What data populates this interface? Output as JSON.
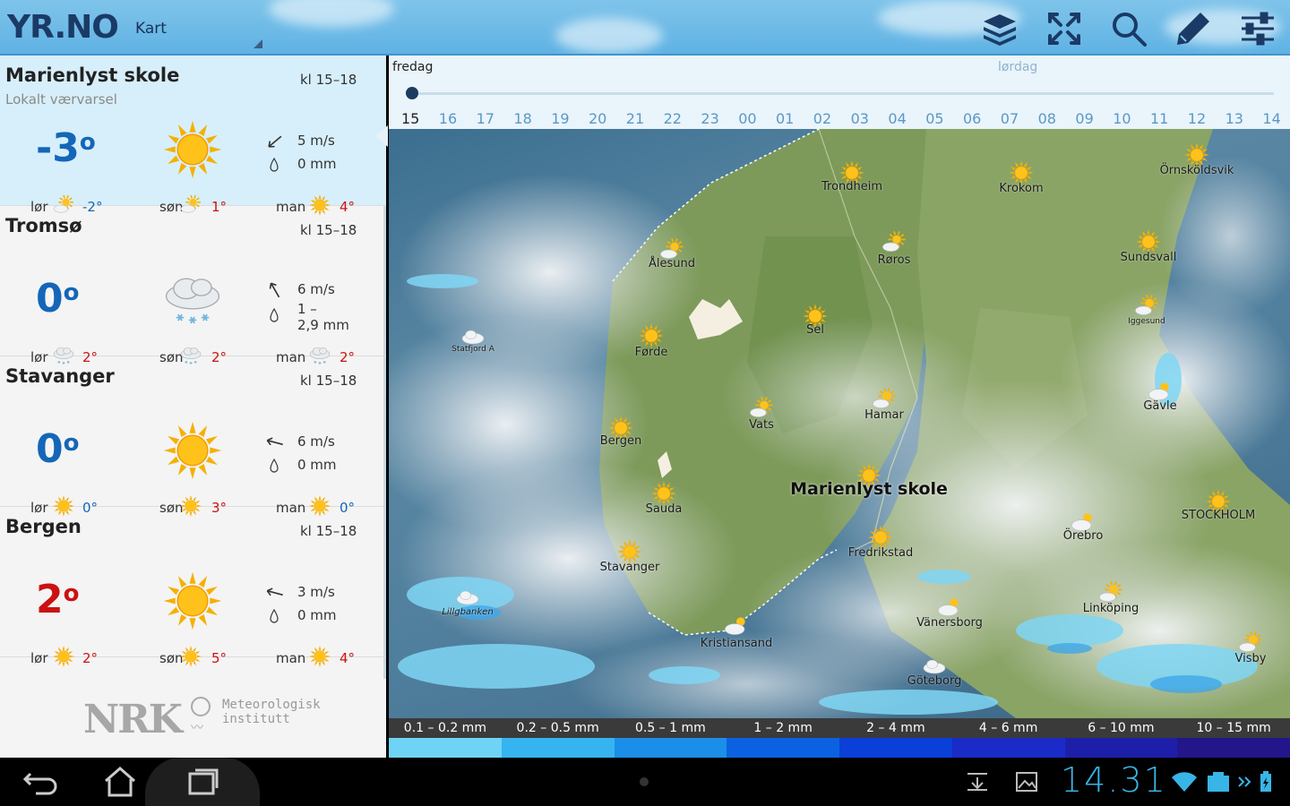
{
  "app": {
    "logo": "YR.NO",
    "section": "Kart"
  },
  "toolbar": {
    "icons": [
      "layers-icon",
      "fullscreen-icon",
      "search-icon",
      "edit-icon",
      "settings-sliders-icon"
    ]
  },
  "locations": [
    {
      "name": "Marienlyst skole",
      "subtitle": "Lokalt værvarsel",
      "time": "kl 15–18",
      "temp": "-3",
      "deg": "o",
      "temp_color": "blue",
      "icon": "sun-icon",
      "wind": "5 m/s",
      "precip": "0  mm",
      "forecast": [
        {
          "day": "lør",
          "icon": "partly-sunny-icon",
          "temp": "-2°",
          "color": "blue"
        },
        {
          "day": "søn",
          "icon": "partly-sunny-icon",
          "temp": "1°",
          "color": "red"
        },
        {
          "day": "man",
          "icon": "sun-icon",
          "temp": "4°",
          "color": "red"
        }
      ]
    },
    {
      "name": "Tromsø",
      "subtitle": "",
      "time": "kl 15–18",
      "temp": "0",
      "deg": "o",
      "temp_color": "blue",
      "icon": "snow-cloud-icon",
      "wind": "6 m/s",
      "precip": "1 –",
      "precip2": "2,9  mm",
      "forecast": [
        {
          "day": "lør",
          "icon": "snow-cloud-icon",
          "temp": "2°",
          "color": "red"
        },
        {
          "day": "søn",
          "icon": "snow-cloud-icon",
          "temp": "2°",
          "color": "red"
        },
        {
          "day": "man",
          "icon": "snow-cloud-icon",
          "temp": "2°",
          "color": "red"
        }
      ]
    },
    {
      "name": "Stavanger",
      "subtitle": "",
      "time": "kl 15–18",
      "temp": "0",
      "deg": "o",
      "temp_color": "blue",
      "icon": "sun-icon",
      "wind": "6 m/s",
      "precip": "0  mm",
      "forecast": [
        {
          "day": "lør",
          "icon": "sun-icon",
          "temp": "0°",
          "color": "blue"
        },
        {
          "day": "søn",
          "icon": "sun-icon",
          "temp": "3°",
          "color": "red"
        },
        {
          "day": "man",
          "icon": "sun-icon",
          "temp": "0°",
          "color": "blue"
        }
      ]
    },
    {
      "name": "Bergen",
      "subtitle": "",
      "time": "kl 15–18",
      "temp": "2",
      "deg": "o",
      "temp_color": "red",
      "icon": "sun-icon",
      "wind": "3 m/s",
      "precip": "0  mm",
      "forecast": [
        {
          "day": "lør",
          "icon": "sun-icon",
          "temp": "2°",
          "color": "red"
        },
        {
          "day": "søn",
          "icon": "sun-icon",
          "temp": "5°",
          "color": "red"
        },
        {
          "day": "man",
          "icon": "sun-icon",
          "temp": "4°",
          "color": "red"
        }
      ]
    }
  ],
  "brand": {
    "nrk": "NRK",
    "met_line1": "Meteorologisk",
    "met_line2": "institutt"
  },
  "timeline": {
    "day1": "fredag",
    "day2": "lørdag",
    "hours": [
      "15",
      "16",
      "17",
      "18",
      "19",
      "20",
      "21",
      "22",
      "23",
      "00",
      "01",
      "02",
      "03",
      "04",
      "05",
      "06",
      "07",
      "08",
      "09",
      "10",
      "11",
      "12",
      "13",
      "14"
    ],
    "current_index": 0
  },
  "map": {
    "cities": [
      {
        "name": "Trondheim",
        "icon": "sun-icon"
      },
      {
        "name": "Krokom",
        "icon": "sun-icon"
      },
      {
        "name": "Örnsköldsvik",
        "icon": "sun-icon"
      },
      {
        "name": "Ålesund",
        "icon": "partly-sunny-icon"
      },
      {
        "name": "Røros",
        "icon": "partly-sunny-icon"
      },
      {
        "name": "Sundsvall",
        "icon": "sun-icon"
      },
      {
        "name": "Statfjord A",
        "icon": "cloud-icon"
      },
      {
        "name": "Førde",
        "icon": "sun-icon"
      },
      {
        "name": "Sel",
        "icon": "sun-icon"
      },
      {
        "name": "Iggesund",
        "icon": "partly-sunny-icon"
      },
      {
        "name": "Gävle",
        "icon": "partly-cloudy-icon"
      },
      {
        "name": "Hamar",
        "icon": "partly-sunny-icon"
      },
      {
        "name": "Vats",
        "icon": "partly-sunny-icon"
      },
      {
        "name": "Bergen",
        "icon": "sun-icon"
      },
      {
        "name": "Marienlyst skole",
        "icon": "sun-icon"
      },
      {
        "name": "Sauda",
        "icon": "sun-icon"
      },
      {
        "name": "STOCKHOLM",
        "icon": "sun-icon"
      },
      {
        "name": "Örebro",
        "icon": "partly-cloudy-icon"
      },
      {
        "name": "Fredrikstad",
        "icon": "sun-icon"
      },
      {
        "name": "Stavanger",
        "icon": "sun-icon"
      },
      {
        "name": "Lillgbanken",
        "icon": "cloud-icon"
      },
      {
        "name": "Vänersborg",
        "icon": "partly-cloudy-icon"
      },
      {
        "name": "Linköping",
        "icon": "partly-sunny-icon"
      },
      {
        "name": "Kristiansand",
        "icon": "partly-cloudy-icon"
      },
      {
        "name": "Visby",
        "icon": "partly-sunny-icon"
      },
      {
        "name": "Göteborg",
        "icon": "cloud-icon"
      }
    ]
  },
  "legend": [
    {
      "label": "0.1 – 0.2 mm",
      "color": "#6fd3f5"
    },
    {
      "label": "0.2 – 0.5 mm",
      "color": "#36b4f0"
    },
    {
      "label": "0.5 – 1 mm",
      "color": "#1a8ee8"
    },
    {
      "label": "1 – 2 mm",
      "color": "#0b62e0"
    },
    {
      "label": "2 – 4 mm",
      "color": "#0a3fd8"
    },
    {
      "label": "4 – 6 mm",
      "color": "#1a2bc8"
    },
    {
      "label": "6 – 10 mm",
      "color": "#1e1fa8"
    },
    {
      "label": "10 – 15 mm",
      "color": "#22168a"
    }
  ],
  "system": {
    "clock": "14.31"
  }
}
